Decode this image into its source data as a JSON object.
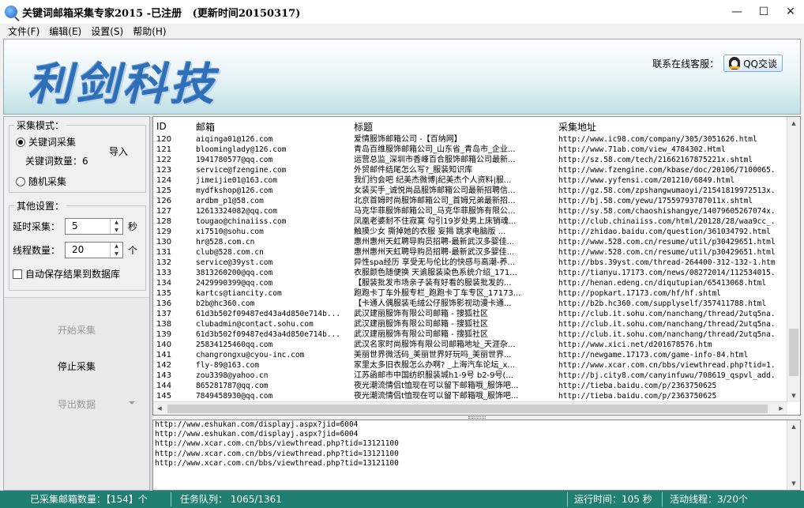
{
  "window": {
    "title": "关键词邮箱采集专家2015 -已注册   (更新时间20150317)",
    "controls": [
      "—",
      "☐",
      "✕"
    ]
  },
  "menu": [
    "文件(F)",
    "编辑(E)",
    "设置(S)",
    "帮助(H)"
  ],
  "banner": {
    "logo_text": "利剑科技",
    "contact_label": "联系在线客服：",
    "qq_button": "QQ交谈"
  },
  "collect_mode": {
    "legend": "采集模式：",
    "keyword_option": "关键词采集",
    "keyword_count_label": "关键词数量：6",
    "import_button": "导入",
    "random_option": "随机采集",
    "selected": "keyword"
  },
  "other_settings": {
    "legend": "其他设置：",
    "delay_label": "延时采集：",
    "delay_value": "5",
    "delay_unit": "秒",
    "threads_label": "线程数量：",
    "threads_value": "20",
    "threads_unit": "个",
    "autosave_label": "自动保存结果到数据库",
    "autosave_checked": false
  },
  "actions": {
    "start": "开始采集",
    "stop": "停止采集",
    "export": "导出数据"
  },
  "table": {
    "headers": [
      "ID",
      "邮箱",
      "标题",
      "采集地址"
    ],
    "rows": [
      [
        "120",
        "aiqinga01@126.com",
        "爱情服饰邮箱公司 -【百纳网】",
        "http://www.ic98.com/company/305/3051626.html"
      ],
      [
        "121",
        "bloominglady@126.com",
        "青岛百维服饰邮箱公司_山东省_青岛市_企业...",
        "http://www.71ab.com/view_4784302.Html"
      ],
      [
        "122",
        "1941780577@qq.com",
        "运营总监_深圳市香峰百合服饰邮箱公司最新...",
        "http://sz.58.com/tech/21662167875221x.shtml"
      ],
      [
        "123",
        "service@fzengine.com",
        "外贸邮件结尾怎么写?_服装知识库",
        "http://www.fzengine.com/kbase/doc/20106/7100065."
      ],
      [
        "124",
        "jimeijie01@163.com",
        "我们约会吧 纪美杰微博|纪美杰个人资料|服...",
        "http://www.yyfensi.com/201210/6849.html"
      ],
      [
        "125",
        "mydfkshop@126.com",
        "女装买手_诚悦尚品服饰邮箱公司最新招聘信...",
        "http://gz.58.com/zpshangwumaoyi/21541819972513x."
      ],
      [
        "126",
        "ardbm_p1@58.com",
        "北京首姆时尚服饰邮箱公司_首姆兄弟最新招...",
        "http://bj.58.com/yewu/17559793787011x.shtml"
      ],
      [
        "127",
        "12613324082@qq.com",
        "马克华菲服饰邮箱公司_马克华菲服饰有限公...",
        "http://sy.58.com/chaoshishangye/14079605267074x."
      ],
      [
        "128",
        "tougao@chinaiiss.com",
        "凤凰老婆耐不住寂寞 勾引19岁处男上床销魂...",
        "http://club.chinaiiss.com/html/20128/28/waa9cc_."
      ],
      [
        "129",
        "xi7510@sohu.com",
        "触摸少女 撕掉她的衣服 妄揭 跳求电脑版 ...",
        "http://zhidao.baidu.com/question/361034792.html"
      ],
      [
        "130",
        "hr@528.com.cn",
        "惠州惠州天虹聘导购员招聘-最新武汉多婴佳...",
        "http://www.528.com.cn/resume/util/p30429651.html"
      ],
      [
        "131",
        "club@528.com.cn",
        "惠州惠州天虹聘导购员招聘-最新武汉多婴佳...",
        "http://www.528.com.cn/resume/util/p30429651.html"
      ],
      [
        "132",
        "service@39yst.com",
        "异性spa经历 享受无与伦比的快感与高潮-养...",
        "http://bbs.39yst.com/thread-264400-312-132-1.htm"
      ],
      [
        "133",
        "3813260200@qq.com",
        "衣服颜色随便换 天谕服装染色系统介绍_171...",
        "http://tianyu.17173.com/news/08272014/112534015."
      ],
      [
        "134",
        "2429990399@qq.com",
        "【服装批发市场亲子装有好看的服装批发的...",
        "http://henan.edeng.cn/diqutupian/65413068.html"
      ],
      [
        "135",
        "kartcs@tiancity.com",
        "跑跑卡丁车外服专栏_跑跑卡丁车专区_17173...",
        "http://popkart.17173.com/hf/hf.shtml"
      ],
      [
        "136",
        "b2b@hc360.com",
        "【卡通人偶服装毛绒公仔服饰影视动漫卡通...",
        "http://b2b.hc360.com/supplyself/357411788.html"
      ],
      [
        "137",
        "61d3b502f09487ed43a4d850e714b...",
        "武汉建丽服饰有限公司邮箱 - 搜狐社区",
        "http://club.it.sohu.com/nanchang/thread/2utq5na."
      ],
      [
        "138",
        "clubadmin@contact.sohu.com",
        "武汉建丽服饰有限公司邮箱 - 搜狐社区",
        "http://club.it.sohu.com/nanchang/thread/2utq5na."
      ],
      [
        "139",
        "61d3b502f09487ed43a4d850e714b...",
        "武汉建丽服饰有限公司邮箱 - 搜狐社区",
        "http://club.it.sohu.com/nanchang/thread/2utq5na."
      ],
      [
        "140",
        "25834125460qq.com",
        "武汉名家时尚服饰有限公司邮箱地址_天涯杂...",
        "http://www.xici.net/d201678576.htm"
      ],
      [
        "141",
        "changrongxu@cyou-inc.com",
        "美丽世界微活码_美丽世界好玩吗_美丽世界...",
        "http://newgame.17173.com/game-info-84.html"
      ],
      [
        "142",
        "fly-89@163.com",
        "家里太多旧衣服怎么办啊? _上海汽车论坛_x...",
        "http://www.xcar.com.cn/bbs/viewthread.php?tid=1."
      ],
      [
        "143",
        "zou3398@yahoo.cn",
        "江苏函邮市中国纺织服装城h1-9号 b2-9号(...",
        "http://bj.city8.com/canyinfuwu/708619_qspvl_add."
      ],
      [
        "144",
        "865281787@qq.com",
        "夜光潮流情侣t恤现在可以留下邮箱哦_服饰吧...",
        "http://tieba.baidu.com/p/2363750625"
      ],
      [
        "145",
        "7849458930@qq.com",
        "夜光潮流情侣t恤现在可以留下邮箱哦_服饰吧...",
        "http://tieba.baidu.com/p/2363750625"
      ]
    ]
  },
  "log": [
    "http://www.eshukan.com/displayj.aspx?jid=6004",
    "http://www.eshukan.com/displayj.aspx?jid=6004",
    "http://www.xcar.com.cn/bbs/viewthread.php?tid=13121100",
    "http://www.xcar.com.cn/bbs/viewthread.php?tid=13121100",
    "http://www.xcar.com.cn/bbs/viewthread.php?tid=13121100"
  ],
  "status": {
    "collected": "已采集邮箱数量：【154】个",
    "queue": "任务队列： 1065/1361",
    "runtime": "运行时间：105 秒",
    "threads": "活动线程：3/20个"
  }
}
